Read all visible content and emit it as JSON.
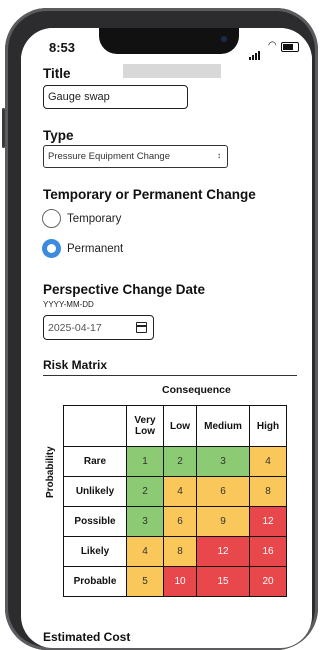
{
  "status_bar": {
    "time": "8:53"
  },
  "form": {
    "title_label": "Title",
    "title_value": "Gauge swap",
    "type_label": "Type",
    "type_value": "Pressure Equipment Change",
    "change_label": "Temporary or Permanent Change",
    "options": [
      {
        "label": "Temporary",
        "selected": false
      },
      {
        "label": "Permanent",
        "selected": true
      }
    ],
    "date_label": "Perspective Change Date",
    "date_format": "YYYY-MM-DD",
    "date_value": "2025-04-17",
    "cost_label": "Estimated Cost"
  },
  "risk_matrix": {
    "title": "Risk Matrix",
    "consequence_label": "Consequence",
    "probability_label": "Probability",
    "columns": [
      "Very Low",
      "Low",
      "Medium",
      "High"
    ],
    "rows": [
      {
        "label": "Rare",
        "values": [
          "1",
          "2",
          "3",
          "4"
        ],
        "colors": [
          "g",
          "g",
          "g",
          "y"
        ]
      },
      {
        "label": "Unlikely",
        "values": [
          "2",
          "4",
          "6",
          "8"
        ],
        "colors": [
          "g",
          "y",
          "y",
          "y"
        ]
      },
      {
        "label": "Possible",
        "values": [
          "3",
          "6",
          "9",
          "12"
        ],
        "colors": [
          "g",
          "y",
          "y",
          "r"
        ]
      },
      {
        "label": "Likely",
        "values": [
          "4",
          "8",
          "12",
          "16"
        ],
        "colors": [
          "y",
          "y",
          "r",
          "r"
        ]
      },
      {
        "label": "Probable",
        "values": [
          "5",
          "10",
          "15",
          "20"
        ],
        "colors": [
          "y",
          "r",
          "r",
          "r"
        ]
      }
    ],
    "palette": {
      "green": "#8cca73",
      "yellow": "#f9c75a",
      "red": "#e8474c"
    }
  },
  "icons": [
    "calendar-icon",
    "chevron-updown-icon",
    "signal-icon",
    "wifi-icon",
    "battery-icon"
  ]
}
